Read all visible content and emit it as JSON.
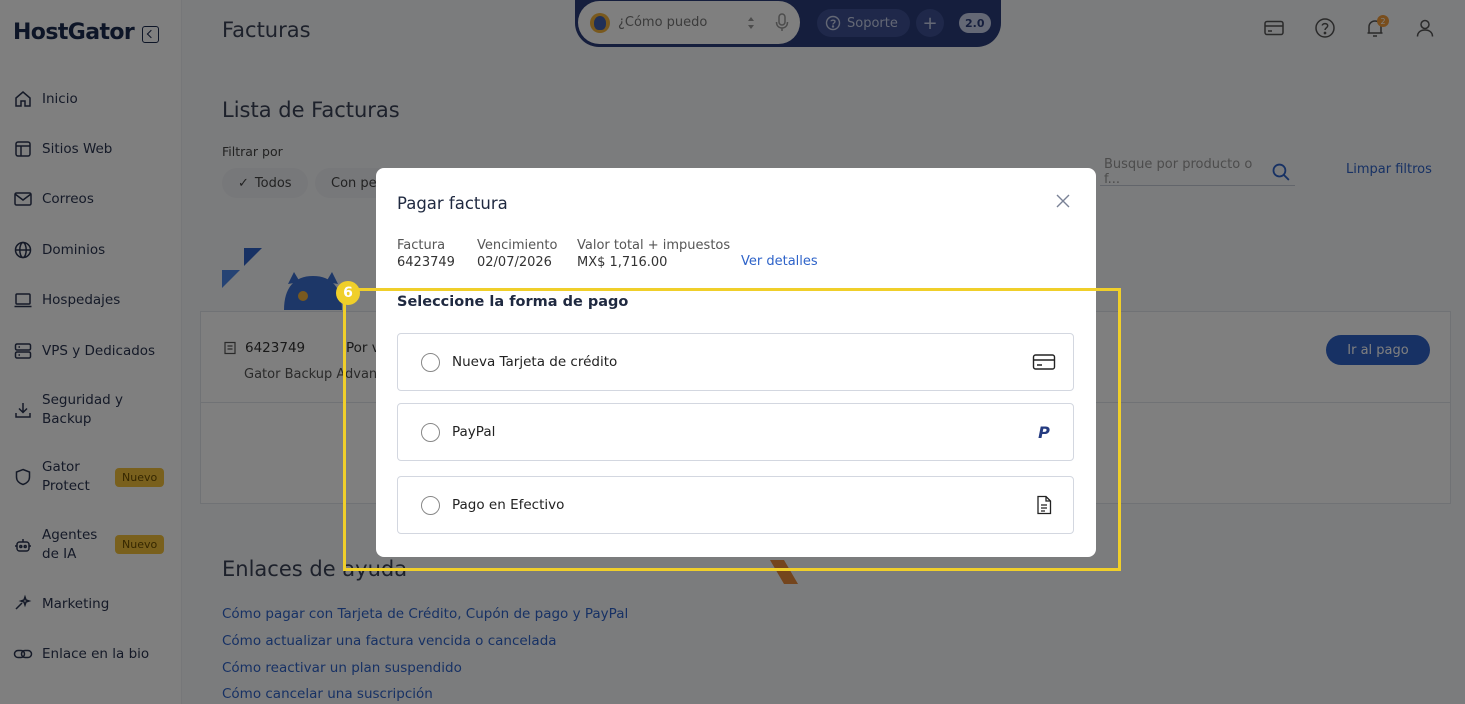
{
  "app": {
    "logo_text": "HostGator",
    "page_heading": "Facturas"
  },
  "sidebar": {
    "items": [
      {
        "label": "Inicio",
        "icon": "home-icon"
      },
      {
        "label": "Sitios Web",
        "icon": "layout-icon"
      },
      {
        "label": "Correos",
        "icon": "mail-icon"
      },
      {
        "label": "Dominios",
        "icon": "globe-icon"
      },
      {
        "label": "Hospedajes",
        "icon": "laptop-icon"
      },
      {
        "label": "VPS y Dedicados",
        "icon": "server-icon"
      },
      {
        "label": "Seguridad y Backup",
        "icon": "download-icon"
      },
      {
        "label": "Gator Protect",
        "icon": "shield-icon",
        "badge": "Nuevo"
      },
      {
        "label": "Agentes de IA",
        "icon": "robot-icon",
        "badge": "Nuevo"
      },
      {
        "label": "Marketing",
        "icon": "sparkle-icon"
      },
      {
        "label": "Enlace en la bio",
        "icon": "link-icon"
      }
    ]
  },
  "topbar": {
    "assistant_placeholder": "¿Cómo puedo",
    "support_label": "Soporte",
    "plus_label": "+",
    "version_badge": "2.0",
    "notification_count": "2"
  },
  "main": {
    "section_title": "Lista de Facturas",
    "filter_label": "Filtrar por",
    "filters": [
      {
        "label": "Todos",
        "checkmark": "✓"
      },
      {
        "label": "Con pe"
      }
    ],
    "search_placeholder": "Busque por producto o f...",
    "clear_filters": "Limpar filtros",
    "invoice": {
      "number": "6423749",
      "due_text": "Por ve",
      "product": "Gator Backup Advanc",
      "pay_button": "Ir al pago"
    },
    "help_title": "Enlaces de ayuda",
    "help_links": [
      "Cómo pagar con Tarjeta de Crédito, Cupón de pago y PayPal",
      "Cómo actualizar una factura vencida o cancelada",
      "Cómo reactivar un plan suspendido",
      "Cómo cancelar una suscripción"
    ]
  },
  "modal": {
    "title": "Pagar factura",
    "meta": [
      {
        "label": "Factura",
        "value": "6423749"
      },
      {
        "label": "Vencimiento",
        "value": "02/07/2026"
      },
      {
        "label": "Valor total + impuestos",
        "value": "MX$ 1,716.00"
      }
    ],
    "details_link": "Ver detalles",
    "select_title": "Seleccione la forma de pago",
    "options": [
      {
        "label": "Nueva Tarjeta de crédito",
        "icon": "credit-card-icon"
      },
      {
        "label": "PayPal",
        "icon": "paypal-icon",
        "icon_text": "P"
      },
      {
        "label": "Pago en Efectivo",
        "icon": "document-icon"
      }
    ]
  },
  "tutorial": {
    "step_number": "6",
    "highlight_color": "#f0cf2a"
  },
  "colors": {
    "brand": "#1b2a4e",
    "link": "#2e63c9",
    "badge_new": "#f3c13a",
    "assistant_bar": "#2b3d7a"
  }
}
